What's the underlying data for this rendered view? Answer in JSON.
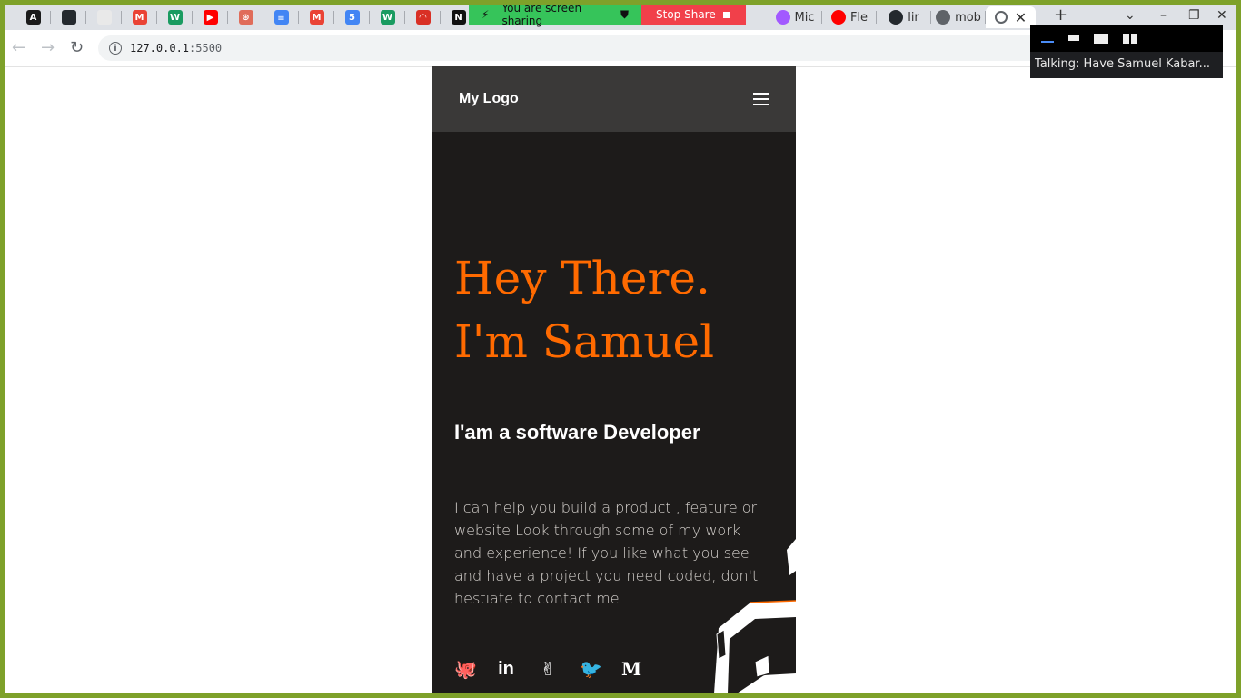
{
  "browser": {
    "tabs": [
      {
        "icon": "astro-icon",
        "color": "#1b1b1b",
        "glyph": "A"
      },
      {
        "icon": "github-icon",
        "color": "#24292e",
        "glyph": ""
      },
      {
        "icon": "photos-icon",
        "color": "#e9e9e9",
        "glyph": ""
      },
      {
        "icon": "gmail-icon",
        "color": "#ea4335",
        "glyph": "M"
      },
      {
        "icon": "w3-icon",
        "color": "#1a9b61",
        "glyph": "W"
      },
      {
        "icon": "youtube-icon",
        "color": "#ff0000",
        "glyph": "▶"
      },
      {
        "icon": "openai-icon",
        "color": "#e06c5a",
        "glyph": "⊛"
      },
      {
        "icon": "docs-icon",
        "color": "#4285f4",
        "glyph": "≡"
      },
      {
        "icon": "gmail-icon",
        "color": "#ea4335",
        "glyph": "M"
      },
      {
        "icon": "calendar-icon",
        "color": "#4285f4",
        "glyph": "5"
      },
      {
        "icon": "w3-icon",
        "color": "#1a9b61",
        "glyph": "W"
      },
      {
        "icon": "speed-icon",
        "color": "#d93025",
        "glyph": "◠"
      },
      {
        "icon": "notion-icon",
        "color": "#111",
        "glyph": "N"
      }
    ],
    "named_tabs": [
      {
        "icon": "figma-icon",
        "title": "Mic",
        "color": "#a259ff"
      },
      {
        "icon": "youtube-icon",
        "title": "Fle",
        "color": "#ff0000"
      },
      {
        "icon": "github-icon",
        "title": "lir",
        "color": "#24292e"
      },
      {
        "icon": "globe-icon",
        "title": "mob",
        "color": "#5f6368"
      }
    ],
    "screen_share": {
      "status": "You are screen sharing",
      "stop_label": "Stop Share"
    },
    "url_host": "127.0.0.1",
    "url_port": ":5500",
    "overlay_text": "Talking: Have Samuel Kabar..."
  },
  "page": {
    "logo": "My Logo",
    "hero_line1": "Hey There.",
    "hero_line2": "I'm Samuel",
    "role": "I'am a software Developer",
    "description": "I can help you build a product , feature or website Look through some of my work and experience! If you like what you see and have a project you need coded, don't hestiate to contact me.",
    "socials": [
      {
        "name": "github-icon",
        "glyph": "🐙"
      },
      {
        "name": "linkedin-icon",
        "glyph": "in"
      },
      {
        "name": "angellist-icon",
        "glyph": "✌"
      },
      {
        "name": "twitter-icon",
        "glyph": "🐦"
      },
      {
        "name": "medium-icon",
        "glyph": "M"
      }
    ],
    "accent_color": "#ff6a00"
  }
}
